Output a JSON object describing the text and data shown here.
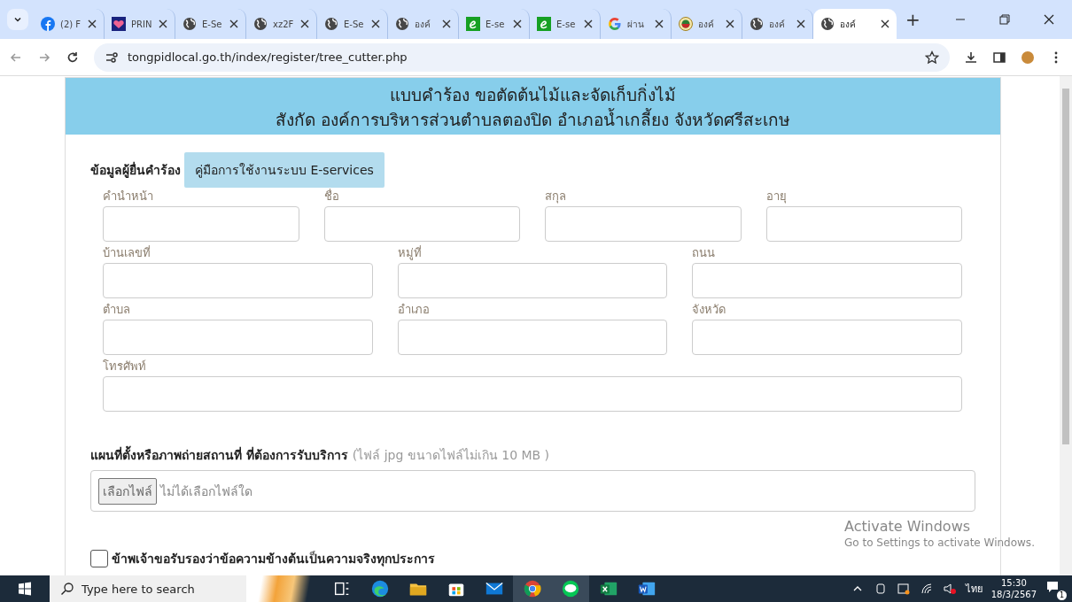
{
  "browser": {
    "tabs": [
      {
        "title": "(2) F",
        "kind": "facebook",
        "selected": false
      },
      {
        "title": "PRIN",
        "kind": "heart",
        "selected": false
      },
      {
        "title": "E-Se",
        "kind": "globe",
        "selected": false
      },
      {
        "title": "xz2F",
        "kind": "globe",
        "selected": false
      },
      {
        "title": "E-Se",
        "kind": "globe",
        "selected": false
      },
      {
        "title": "องค์",
        "kind": "globe",
        "selected": false
      },
      {
        "title": "E-se",
        "kind": "eletter",
        "selected": false
      },
      {
        "title": "E-se",
        "kind": "eletter",
        "selected": false
      },
      {
        "title": "ผ่าน",
        "kind": "google",
        "selected": false
      },
      {
        "title": "องค์",
        "kind": "emblem",
        "selected": false
      },
      {
        "title": "องค์",
        "kind": "globe",
        "selected": false
      },
      {
        "title": "องค์",
        "kind": "globe",
        "selected": true
      }
    ],
    "new_tab": "+",
    "url": "tongpidlocal.go.th/index/register/tree_cutter.php"
  },
  "form": {
    "title_lines": [
      "แบบคำร้อง ขอตัดต้นไม้และจัดเก็บกิ่งไม้",
      "สังกัด องค์การบริหารส่วนตำบลตองปิด อำเภอน้ำเกลี้ยง จังหวัดศรีสะเกษ"
    ],
    "section_label": "ข้อมูลผู้ยื่นคำร้อง",
    "manual_button": "คู่มือการใช้งานระบบ E-services",
    "field_rows": [
      [
        {
          "label": "คำนำหน้า"
        },
        {
          "label": "ชื่อ"
        },
        {
          "label": "สกุล"
        },
        {
          "label": "อายุ"
        }
      ],
      [
        {
          "label": "บ้านเลขที่"
        },
        {
          "label": "หมู่ที่"
        },
        {
          "label": "ถนน"
        }
      ],
      [
        {
          "label": "ตำบล"
        },
        {
          "label": "อำเภอ"
        },
        {
          "label": "จังหวัด"
        }
      ],
      [
        {
          "label": "โทรศัพท์"
        }
      ]
    ],
    "upload": {
      "label": "แผนที่ตั้งหรือภาพถ่ายสถานที่ ที่ต้องการรับบริการ",
      "hint": "(ไฟล์ jpg ขนาดไฟล์ไม่เกิน 10 MB )",
      "choose_button": "เลือกไฟล์",
      "no_file": "ไม่ได้เลือกไฟล์ใด"
    },
    "consent": {
      "text": "ข้าพเจ้าขอรับรองว่าข้อความข้างต้นเป็นความจริงทุกประการ",
      "checked": false
    }
  },
  "activation": {
    "title": "Activate Windows",
    "subtitle": "Go to Settings to activate Windows."
  },
  "taskbar": {
    "search_placeholder": "Type here to search",
    "apps": [
      {
        "kind": "taskview",
        "selected": false
      },
      {
        "kind": "edge",
        "selected": false
      },
      {
        "kind": "folder",
        "selected": false
      },
      {
        "kind": "store",
        "selected": false
      },
      {
        "kind": "mail",
        "selected": false
      },
      {
        "kind": "chrome",
        "selected": true
      },
      {
        "kind": "line",
        "selected": true
      },
      {
        "kind": "excel",
        "selected": false
      },
      {
        "kind": "word",
        "selected": false
      }
    ],
    "language": "ไทย",
    "time": "15:30",
    "date": "18/3/2567",
    "notifications": "1"
  }
}
